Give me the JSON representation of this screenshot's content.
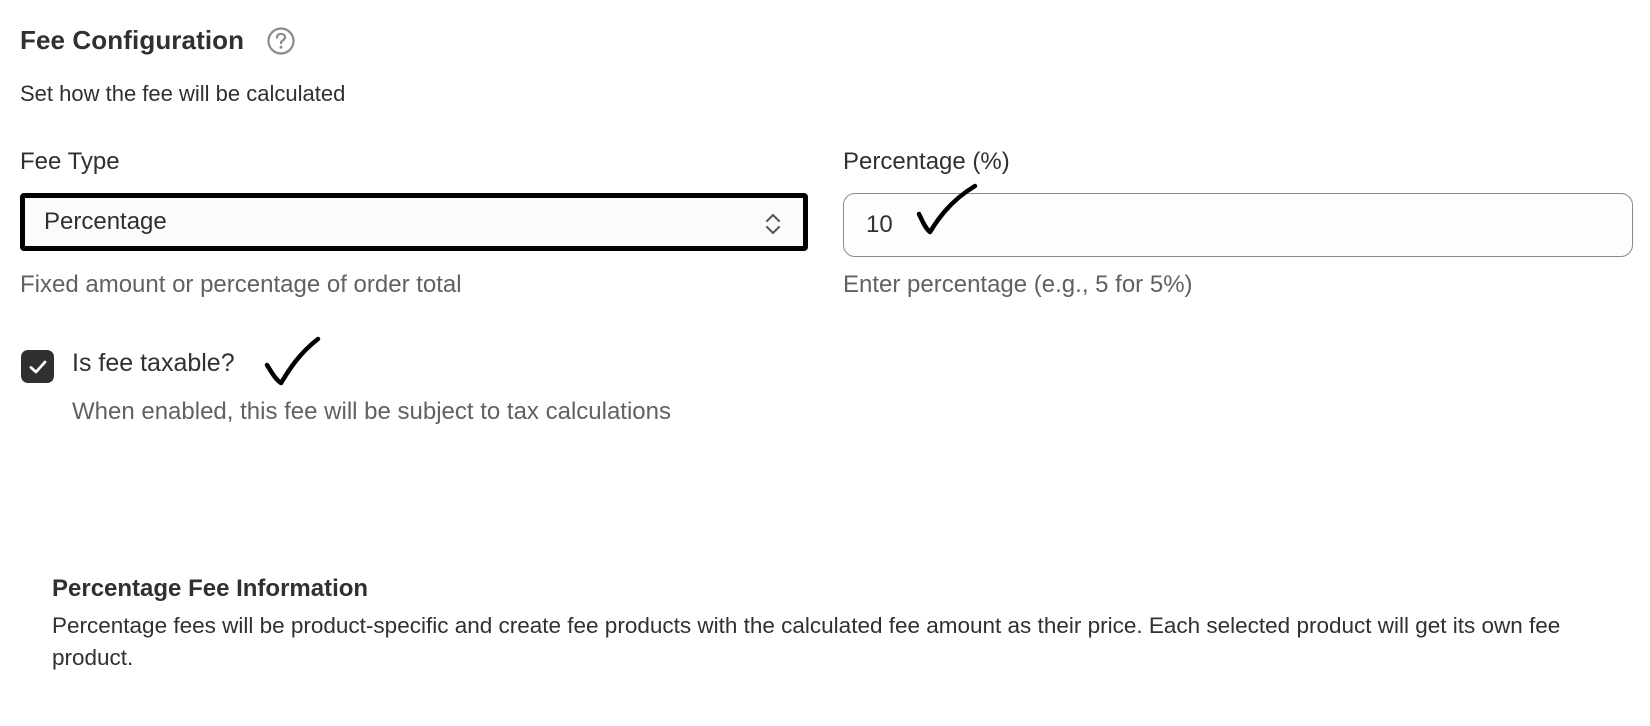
{
  "section": {
    "title": "Fee Configuration",
    "subtitle": "Set how the fee will be calculated"
  },
  "fee_type": {
    "label": "Fee Type",
    "selected_value": "Percentage",
    "help_text": "Fixed amount or percentage of order total"
  },
  "percentage": {
    "label": "Percentage (%)",
    "value": "10",
    "help_text": "Enter percentage (e.g., 5 for 5%)"
  },
  "taxable": {
    "label": "Is fee taxable?",
    "checked": true,
    "help_text": "When enabled, this fee will be subject to tax calculations"
  },
  "info": {
    "title": "Percentage Fee Information",
    "body": "Percentage fees will be product-specific and create fee products with the calculated fee amount as their price. Each selected product will get its own fee product."
  },
  "icons": {
    "help": "question-circle-icon",
    "select": "chevron-up-down-icon",
    "checkbox": "checkmark-icon",
    "annotation": "handwritten-checkmark"
  },
  "colors": {
    "text": "#303030",
    "muted": "#616161",
    "checkbox_fill": "#303030",
    "select_border": "#000000"
  }
}
